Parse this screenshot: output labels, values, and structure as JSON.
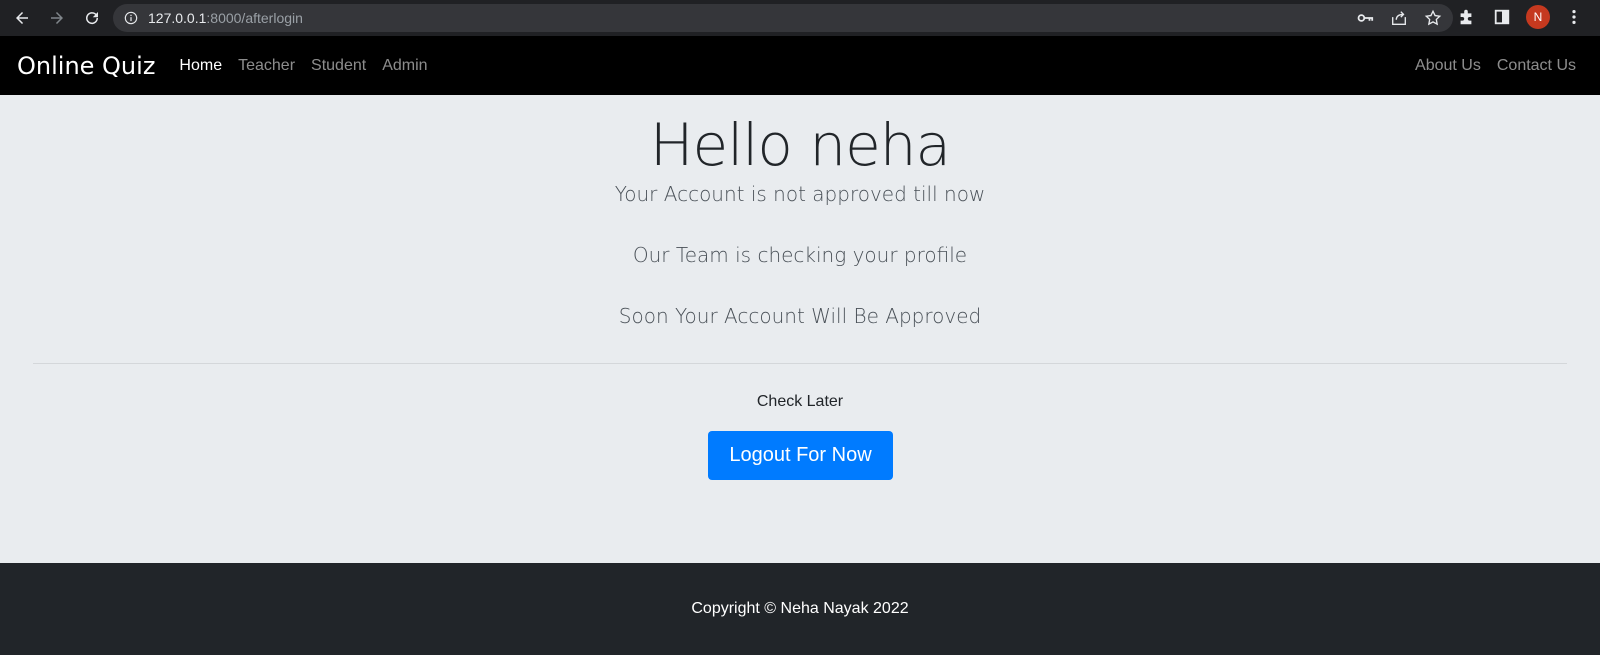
{
  "browser": {
    "url_host": "127.0.0.1",
    "url_path": ":8000/afterlogin",
    "profile_initial": "N"
  },
  "navbar": {
    "brand": "Online Quiz",
    "links": [
      "Home",
      "Teacher",
      "Student",
      "Admin"
    ],
    "right_links": [
      "About Us",
      "Contact Us"
    ]
  },
  "main": {
    "greeting": "Hello neha",
    "lines": [
      "Your Account is not approved till now",
      "Our Team is checking your profile",
      "Soon Your Account Will Be Approved"
    ],
    "check_later": "Check Later",
    "logout_label": "Logout For Now"
  },
  "footer": {
    "copyright": "Copyright © Neha Nayak 2022"
  },
  "colors": {
    "navbar_bg": "#000000",
    "page_bg": "#e9ecef",
    "primary": "#007bff",
    "footer_bg": "#212529"
  }
}
